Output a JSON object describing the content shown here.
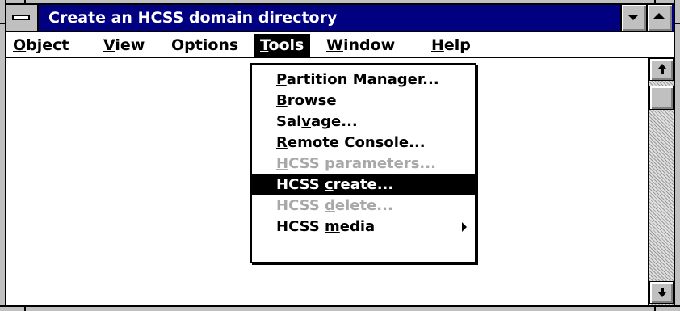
{
  "window": {
    "title": "Create an HCSS domain directory",
    "minimize_icon": "chevron-down-icon",
    "maximize_icon": "chevron-up-icon",
    "system_menu_icon": "system-menu-icon"
  },
  "menubar": {
    "items": [
      {
        "label": "Object",
        "mnemonic_index": 0,
        "active": false
      },
      {
        "label": "View",
        "mnemonic_index": 0,
        "active": false
      },
      {
        "label": "Options",
        "mnemonic_index": -1,
        "active": false
      },
      {
        "label": "Tools",
        "mnemonic_index": 0,
        "active": true
      },
      {
        "label": "Window",
        "mnemonic_index": 0,
        "active": false
      },
      {
        "label": "Help",
        "mnemonic_index": 0,
        "active": false
      }
    ]
  },
  "tools_menu": {
    "items": [
      {
        "label": "Partition Manager...",
        "mnemonic_index": 0,
        "state": "enabled"
      },
      {
        "label": "Browse",
        "mnemonic_index": 0,
        "state": "enabled"
      },
      {
        "label": "Salvage...",
        "mnemonic_index": 3,
        "state": "enabled"
      },
      {
        "label": "Remote Console...",
        "mnemonic_index": 0,
        "state": "enabled"
      },
      {
        "label": "HCSS parameters...",
        "mnemonic_index": 0,
        "state": "disabled"
      },
      {
        "label": "HCSS create...",
        "mnemonic_index": 5,
        "state": "selected"
      },
      {
        "label": "HCSS delete...",
        "mnemonic_index": 5,
        "state": "disabled"
      },
      {
        "label": "HCSS media",
        "mnemonic_index": 5,
        "state": "enabled",
        "has_submenu": true
      }
    ]
  },
  "scrollbar": {
    "up_icon": "scroll-up-arrow-icon",
    "down_icon": "scroll-down-arrow-icon",
    "position": 0
  },
  "colors": {
    "titlebar": "#000080",
    "highlight": "#000000",
    "disabled_text": "#a8a8a8",
    "frame": "#c0c0c0"
  }
}
